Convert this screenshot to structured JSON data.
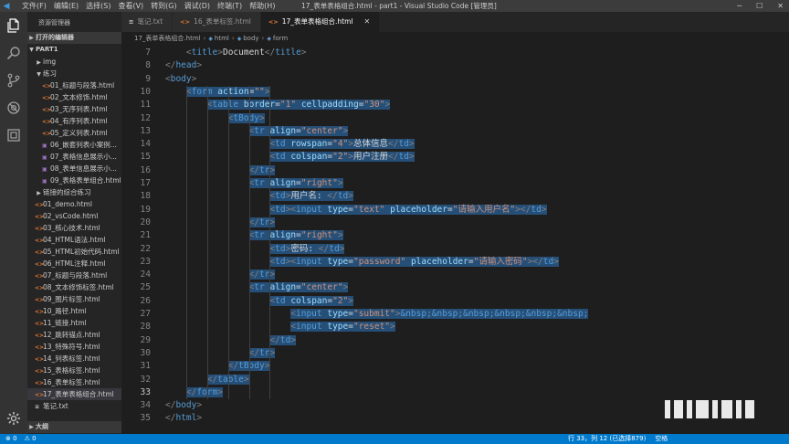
{
  "titlebar": {
    "menu": [
      "文件(F)",
      "编辑(E)",
      "选择(S)",
      "查看(V)",
      "转到(G)",
      "调试(D)",
      "终端(T)",
      "帮助(H)"
    ],
    "title": "17_表单表格组合.html - part1 - Visual Studio Code [管理员]"
  },
  "sidebar": {
    "header": "资源管理器",
    "sections": {
      "open_editors": "打开的编辑器",
      "project": "PART1",
      "outline": "大纲"
    },
    "items": [
      {
        "label": "img",
        "type": "folder",
        "indent": 1
      },
      {
        "label": "练习",
        "type": "folder-open",
        "indent": 1
      },
      {
        "label": "01_标题与段落.html",
        "type": "html",
        "indent": 2
      },
      {
        "label": "02_文本修饰.html",
        "type": "html",
        "indent": 2
      },
      {
        "label": "03_无序列表.html",
        "type": "html",
        "indent": 2
      },
      {
        "label": "04_有序列表.html",
        "type": "html",
        "indent": 2
      },
      {
        "label": "05_定义列表.html",
        "type": "html",
        "indent": 2
      },
      {
        "label": "06_嵌套列表小案例...",
        "type": "img",
        "indent": 2
      },
      {
        "label": "07_表格信息展示小...",
        "type": "img",
        "indent": 2
      },
      {
        "label": "08_表单信息展示小...",
        "type": "img",
        "indent": 2
      },
      {
        "label": "09_表格表单组合.html",
        "type": "img",
        "indent": 2
      },
      {
        "label": "链接的综合练习",
        "type": "folder",
        "indent": 1
      },
      {
        "label": "01_demo.html",
        "type": "html",
        "indent": 1
      },
      {
        "label": "02_vsCode.html",
        "type": "html",
        "indent": 1
      },
      {
        "label": "03_核心技术.html",
        "type": "html",
        "indent": 1
      },
      {
        "label": "04_HTML语法.html",
        "type": "html",
        "indent": 1
      },
      {
        "label": "05_HTML初始代码.html",
        "type": "html",
        "indent": 1
      },
      {
        "label": "06_HTML注释.html",
        "type": "html",
        "indent": 1
      },
      {
        "label": "07_标题与段落.html",
        "type": "html",
        "indent": 1
      },
      {
        "label": "08_文本修饰标签.html",
        "type": "html",
        "indent": 1
      },
      {
        "label": "09_图片标签.html",
        "type": "html",
        "indent": 1
      },
      {
        "label": "10_路径.html",
        "type": "html",
        "indent": 1
      },
      {
        "label": "11_链接.html",
        "type": "html",
        "indent": 1
      },
      {
        "label": "12_跳转锚点.html",
        "type": "html",
        "indent": 1
      },
      {
        "label": "13_特殊符号.html",
        "type": "html",
        "indent": 1
      },
      {
        "label": "14_列表标签.html",
        "type": "html",
        "indent": 1
      },
      {
        "label": "15_表格标签.html",
        "type": "html",
        "indent": 1
      },
      {
        "label": "16_表单标签.html",
        "type": "html",
        "indent": 1
      },
      {
        "label": "17_表单表格组合.html",
        "type": "html",
        "indent": 1,
        "selected": true
      },
      {
        "label": "笔记.txt",
        "type": "txt",
        "indent": 1
      }
    ]
  },
  "tabs": [
    {
      "label": "笔记.txt",
      "icon": "txt"
    },
    {
      "label": "16_表单标签.html",
      "icon": "html"
    },
    {
      "label": "17_表单表格组合.html",
      "icon": "html",
      "active": true
    }
  ],
  "breadcrumb": [
    "17_表单表格组合.html",
    "html",
    "body",
    "form"
  ],
  "editor": {
    "current_line": 33,
    "lines": [
      {
        "n": "7",
        "indent": 4,
        "sel": false,
        "tokens": [
          [
            "br",
            "<"
          ],
          [
            "tag",
            "title"
          ],
          [
            "br",
            ">"
          ],
          [
            "txt",
            "Document"
          ],
          [
            "br",
            "</"
          ],
          [
            "tag",
            "title"
          ],
          [
            "br",
            ">"
          ]
        ]
      },
      {
        "n": "8",
        "indent": 0,
        "sel": false,
        "tokens": [
          [
            "br",
            "</"
          ],
          [
            "tag",
            "head"
          ],
          [
            "br",
            ">"
          ]
        ]
      },
      {
        "n": "9",
        "indent": 0,
        "sel": false,
        "tokens": [
          [
            "br",
            "<"
          ],
          [
            "tag",
            "body"
          ],
          [
            "br",
            ">"
          ]
        ]
      },
      {
        "n": "10",
        "indent": 4,
        "sel": true,
        "tokens": [
          [
            "br",
            "<"
          ],
          [
            "tag",
            "form"
          ],
          [
            "txt",
            " "
          ],
          [
            "attr",
            "action"
          ],
          [
            "txt",
            "="
          ],
          [
            "str",
            "\"\""
          ],
          [
            "br",
            ">"
          ]
        ]
      },
      {
        "n": "11",
        "indent": 8,
        "sel": true,
        "tokens": [
          [
            "br",
            "<"
          ],
          [
            "tag",
            "table"
          ],
          [
            "txt",
            " "
          ],
          [
            "attr",
            "border"
          ],
          [
            "txt",
            "="
          ],
          [
            "str",
            "\"1\""
          ],
          [
            "txt",
            " "
          ],
          [
            "attr",
            "cellpadding"
          ],
          [
            "txt",
            "="
          ],
          [
            "str",
            "\"30\""
          ],
          [
            "br",
            ">"
          ]
        ]
      },
      {
        "n": "12",
        "indent": 12,
        "sel": true,
        "tokens": [
          [
            "br",
            "<"
          ],
          [
            "tag",
            "tBody"
          ],
          [
            "br",
            ">"
          ]
        ]
      },
      {
        "n": "13",
        "indent": 16,
        "sel": true,
        "tokens": [
          [
            "br",
            "<"
          ],
          [
            "tag",
            "tr"
          ],
          [
            "txt",
            " "
          ],
          [
            "attr",
            "align"
          ],
          [
            "txt",
            "="
          ],
          [
            "str",
            "\"center\""
          ],
          [
            "br",
            ">"
          ]
        ]
      },
      {
        "n": "14",
        "indent": 20,
        "sel": true,
        "tokens": [
          [
            "br",
            "<"
          ],
          [
            "tag",
            "td"
          ],
          [
            "txt",
            " "
          ],
          [
            "attr",
            "rowspan"
          ],
          [
            "txt",
            "="
          ],
          [
            "str",
            "\"4\""
          ],
          [
            "br",
            ">"
          ],
          [
            "txt",
            "总体信息"
          ],
          [
            "br",
            "</"
          ],
          [
            "tag",
            "td"
          ],
          [
            "br",
            ">"
          ]
        ]
      },
      {
        "n": "15",
        "indent": 20,
        "sel": true,
        "tokens": [
          [
            "br",
            "<"
          ],
          [
            "tag",
            "td"
          ],
          [
            "txt",
            " "
          ],
          [
            "attr",
            "colspan"
          ],
          [
            "txt",
            "="
          ],
          [
            "str",
            "\"2\""
          ],
          [
            "br",
            ">"
          ],
          [
            "txt",
            "用户注册"
          ],
          [
            "br",
            "</"
          ],
          [
            "tag",
            "td"
          ],
          [
            "br",
            ">"
          ]
        ]
      },
      {
        "n": "16",
        "indent": 16,
        "sel": true,
        "tokens": [
          [
            "br",
            "</"
          ],
          [
            "tag",
            "tr"
          ],
          [
            "br",
            ">"
          ]
        ]
      },
      {
        "n": "17",
        "indent": 16,
        "sel": true,
        "tokens": [
          [
            "br",
            "<"
          ],
          [
            "tag",
            "tr"
          ],
          [
            "txt",
            " "
          ],
          [
            "attr",
            "align"
          ],
          [
            "txt",
            "="
          ],
          [
            "str",
            "\"right\""
          ],
          [
            "br",
            ">"
          ]
        ]
      },
      {
        "n": "18",
        "indent": 20,
        "sel": true,
        "tokens": [
          [
            "br",
            "<"
          ],
          [
            "tag",
            "td"
          ],
          [
            "br",
            ">"
          ],
          [
            "txt",
            "用户名: "
          ],
          [
            "br",
            "</"
          ],
          [
            "tag",
            "td"
          ],
          [
            "br",
            ">"
          ]
        ]
      },
      {
        "n": "19",
        "indent": 20,
        "sel": true,
        "tokens": [
          [
            "br",
            "<"
          ],
          [
            "tag",
            "td"
          ],
          [
            "br",
            "><"
          ],
          [
            "tag",
            "input"
          ],
          [
            "txt",
            " "
          ],
          [
            "attr",
            "type"
          ],
          [
            "txt",
            "="
          ],
          [
            "str",
            "\"text\""
          ],
          [
            "txt",
            " "
          ],
          [
            "attr",
            "placeholder"
          ],
          [
            "txt",
            "="
          ],
          [
            "str",
            "\"请输入用户名\""
          ],
          [
            "br",
            "></"
          ],
          [
            "tag",
            "td"
          ],
          [
            "br",
            ">"
          ]
        ]
      },
      {
        "n": "20",
        "indent": 16,
        "sel": true,
        "tokens": [
          [
            "br",
            "</"
          ],
          [
            "tag",
            "tr"
          ],
          [
            "br",
            ">"
          ]
        ]
      },
      {
        "n": "21",
        "indent": 16,
        "sel": true,
        "tokens": [
          [
            "br",
            "<"
          ],
          [
            "tag",
            "tr"
          ],
          [
            "txt",
            " "
          ],
          [
            "attr",
            "align"
          ],
          [
            "txt",
            "="
          ],
          [
            "str",
            "\"right\""
          ],
          [
            "br",
            ">"
          ]
        ]
      },
      {
        "n": "22",
        "indent": 20,
        "sel": true,
        "tokens": [
          [
            "br",
            "<"
          ],
          [
            "tag",
            "td"
          ],
          [
            "br",
            ">"
          ],
          [
            "txt",
            "密码: "
          ],
          [
            "br",
            "</"
          ],
          [
            "tag",
            "td"
          ],
          [
            "br",
            ">"
          ]
        ]
      },
      {
        "n": "23",
        "indent": 20,
        "sel": true,
        "tokens": [
          [
            "br",
            "<"
          ],
          [
            "tag",
            "td"
          ],
          [
            "br",
            "><"
          ],
          [
            "tag",
            "input"
          ],
          [
            "txt",
            " "
          ],
          [
            "attr",
            "type"
          ],
          [
            "txt",
            "="
          ],
          [
            "str",
            "\"password\""
          ],
          [
            "txt",
            " "
          ],
          [
            "attr",
            "placeholder"
          ],
          [
            "txt",
            "="
          ],
          [
            "str",
            "\"请输入密码\""
          ],
          [
            "br",
            "></"
          ],
          [
            "tag",
            "td"
          ],
          [
            "br",
            ">"
          ]
        ]
      },
      {
        "n": "24",
        "indent": 16,
        "sel": true,
        "tokens": [
          [
            "br",
            "</"
          ],
          [
            "tag",
            "tr"
          ],
          [
            "br",
            ">"
          ]
        ]
      },
      {
        "n": "25",
        "indent": 16,
        "sel": true,
        "tokens": [
          [
            "br",
            "<"
          ],
          [
            "tag",
            "tr"
          ],
          [
            "txt",
            " "
          ],
          [
            "attr",
            "align"
          ],
          [
            "txt",
            "="
          ],
          [
            "str",
            "\"center\""
          ],
          [
            "br",
            ">"
          ]
        ]
      },
      {
        "n": "26",
        "indent": 20,
        "sel": true,
        "tokens": [
          [
            "br",
            "<"
          ],
          [
            "tag",
            "td"
          ],
          [
            "txt",
            " "
          ],
          [
            "attr",
            "colspan"
          ],
          [
            "txt",
            "="
          ],
          [
            "str",
            "\"2\""
          ],
          [
            "br",
            ">"
          ]
        ]
      },
      {
        "n": "27",
        "indent": 24,
        "sel": true,
        "tokens": [
          [
            "br",
            "<"
          ],
          [
            "tag",
            "input"
          ],
          [
            "txt",
            " "
          ],
          [
            "attr",
            "type"
          ],
          [
            "txt",
            "="
          ],
          [
            "str",
            "\"submit\""
          ],
          [
            "br",
            ">"
          ],
          [
            "ent",
            "&nbsp;&nbsp;&nbsp;&nbsp;&nbsp;&nbsp;"
          ]
        ]
      },
      {
        "n": "28",
        "indent": 24,
        "sel": true,
        "tokens": [
          [
            "br",
            "<"
          ],
          [
            "tag",
            "input"
          ],
          [
            "txt",
            " "
          ],
          [
            "attr",
            "type"
          ],
          [
            "txt",
            "="
          ],
          [
            "str",
            "\"reset\""
          ],
          [
            "br",
            ">"
          ]
        ]
      },
      {
        "n": "29",
        "indent": 20,
        "sel": true,
        "tokens": [
          [
            "br",
            "</"
          ],
          [
            "tag",
            "td"
          ],
          [
            "br",
            ">"
          ]
        ]
      },
      {
        "n": "30",
        "indent": 16,
        "sel": true,
        "tokens": [
          [
            "br",
            "</"
          ],
          [
            "tag",
            "tr"
          ],
          [
            "br",
            ">"
          ]
        ]
      },
      {
        "n": "31",
        "indent": 12,
        "sel": true,
        "tokens": [
          [
            "br",
            "</"
          ],
          [
            "tag",
            "tBody"
          ],
          [
            "br",
            ">"
          ]
        ]
      },
      {
        "n": "32",
        "indent": 8,
        "sel": true,
        "tokens": [
          [
            "br",
            "</"
          ],
          [
            "tag",
            "table"
          ],
          [
            "br",
            ">"
          ]
        ]
      },
      {
        "n": "33",
        "indent": 4,
        "sel": true,
        "tokens": [
          [
            "br",
            "</"
          ],
          [
            "tag",
            "form"
          ],
          [
            "br",
            ">"
          ]
        ]
      },
      {
        "n": "34",
        "indent": 0,
        "sel": false,
        "tokens": [
          [
            "br",
            "</"
          ],
          [
            "tag",
            "body"
          ],
          [
            "br",
            ">"
          ]
        ]
      },
      {
        "n": "35",
        "indent": 0,
        "sel": false,
        "tokens": [
          [
            "br",
            "</"
          ],
          [
            "tag",
            "html"
          ],
          [
            "br",
            ">"
          ]
        ]
      }
    ]
  },
  "statusbar": {
    "errors": "0",
    "warnings": "0",
    "position": "行 33，列 12 (已选择879)",
    "spaces": "空格"
  },
  "colors": {
    "accent": "#007acc",
    "selection": "#264f78",
    "html_icon": "#e37933"
  }
}
